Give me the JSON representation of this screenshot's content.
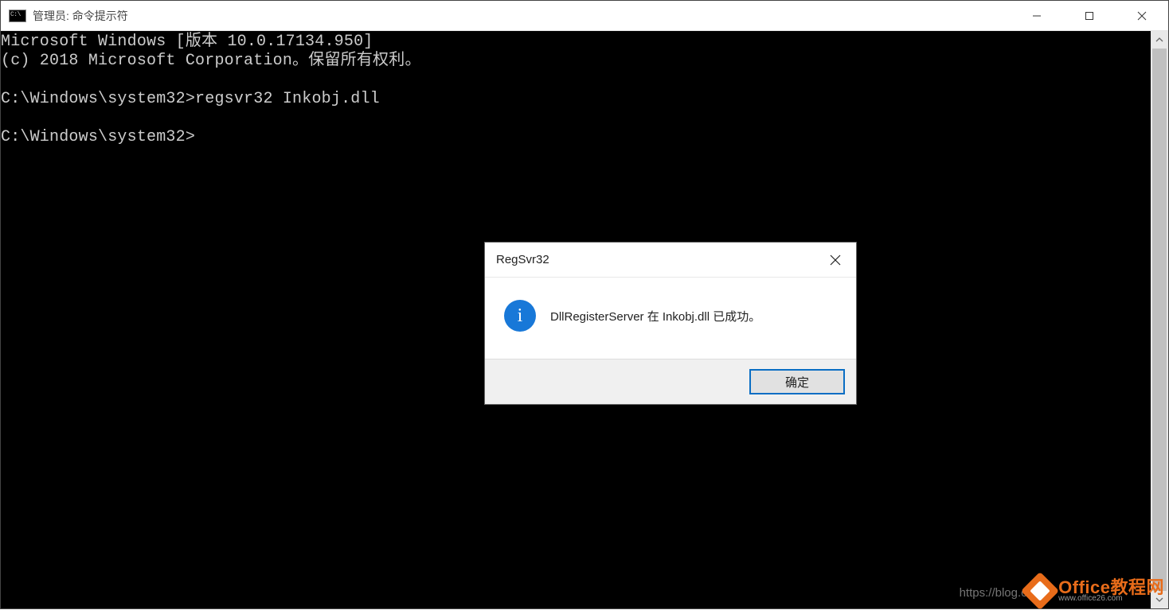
{
  "window": {
    "title": "管理员: 命令提示符"
  },
  "terminal": {
    "line1": "Microsoft Windows [版本 10.0.17134.950]",
    "line2": "(c) 2018 Microsoft Corporation。保留所有权利。",
    "blank1": "",
    "line3": "C:\\Windows\\system32>regsvr32 Inkobj.dll",
    "blank2": "",
    "line4": "C:\\Windows\\system32>"
  },
  "dialog": {
    "title": "RegSvr32",
    "message": "DllRegisterServer 在 Inkobj.dll 已成功。",
    "ok": "确定",
    "info_glyph": "i"
  },
  "watermark": {
    "url_partial": "https://blog.csdn.",
    "brand": "Office教程网",
    "sub": "www.office26.com"
  }
}
